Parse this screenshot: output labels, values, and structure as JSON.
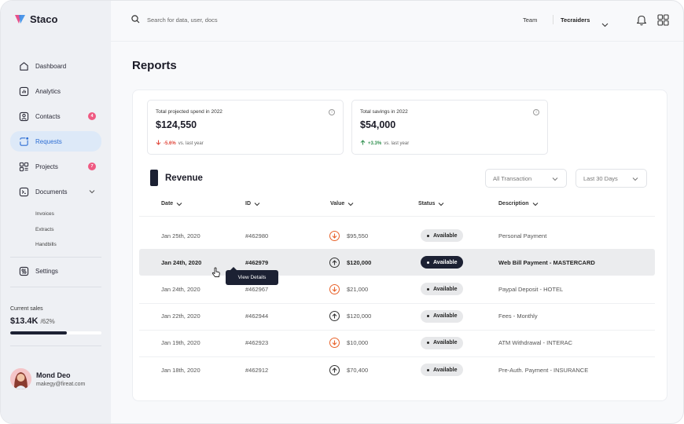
{
  "app": {
    "name": "Staco"
  },
  "sidebar": {
    "items": [
      {
        "label": "Dashboard",
        "icon": "home-icon"
      },
      {
        "label": "Analytics",
        "icon": "analytics-icon"
      },
      {
        "label": "Contacts",
        "icon": "contacts-icon",
        "badge": "4"
      },
      {
        "label": "Requests",
        "icon": "requests-icon",
        "active": true
      },
      {
        "label": "Projects",
        "icon": "projects-icon",
        "badge": "7"
      },
      {
        "label": "Documents",
        "icon": "documents-icon",
        "expandable": true
      }
    ],
    "sub_items": [
      "Invoices",
      "Extracts",
      "Handbills"
    ],
    "settings_label": "Settings",
    "sales": {
      "label": "Current sales",
      "value": "$13.4K",
      "percent_label": "/62%",
      "progress": 0.62
    },
    "user": {
      "name": "Mond Deo",
      "email": "makegy@fireat.com"
    }
  },
  "topbar": {
    "search_placeholder": "Search for data, user, docs",
    "team_label": "Team",
    "org_label": "Tecraiders"
  },
  "page": {
    "title": "Reports"
  },
  "kpis": [
    {
      "title": "Total projected spend in 2022",
      "value": "$124,550",
      "change": "-5.6%",
      "change_suffix": "vs. last year",
      "direction": "down"
    },
    {
      "title": "Total savings in 2022",
      "value": "$54,000",
      "change": "+3.3%",
      "change_suffix": "vs. last year",
      "direction": "up"
    }
  ],
  "revenue": {
    "title": "Revenue",
    "filter_transaction": "All Transaction",
    "filter_period": "Last 30 Days",
    "columns": [
      "Date",
      "ID",
      "Value",
      "Status",
      "Description"
    ],
    "rows": [
      {
        "date": "Jan 25th, 2020",
        "id": "#462980",
        "value": "$95,550",
        "direction": "down",
        "status": "Available",
        "description": "Personal Payment"
      },
      {
        "date": "Jan 24th, 2020",
        "id": "#462979",
        "value": "$120,000",
        "direction": "up",
        "status": "Available",
        "description": "Web Bill Payment - MASTERCARD",
        "highlighted": true
      },
      {
        "date": "Jan 24th, 2020",
        "id": "#462967",
        "value": "$21,000",
        "direction": "down",
        "status": "Available",
        "description": "Paypal Deposit - HOTEL"
      },
      {
        "date": "Jan 22th, 2020",
        "id": "#462944",
        "value": "$120,000",
        "direction": "up",
        "status": "Available",
        "description": "Fees - Monthly"
      },
      {
        "date": "Jan 19th, 2020",
        "id": "#462923",
        "value": "$10,000",
        "direction": "down",
        "status": "Available",
        "description": "ATM Withdrawal - INTERAC"
      },
      {
        "date": "Jan 18th, 2020",
        "id": "#462912",
        "value": "$70,400",
        "direction": "up",
        "status": "Available",
        "description": "Pre-Auth. Payment - INSURANCE"
      }
    ],
    "tooltip": "View Details"
  },
  "colors": {
    "accent": "#2f6fd4",
    "badge": "#ef5a82",
    "dark": "#1c2133",
    "negative": "#e0463a",
    "positive": "#2f8f4e",
    "down_icon": "#e8622a"
  }
}
